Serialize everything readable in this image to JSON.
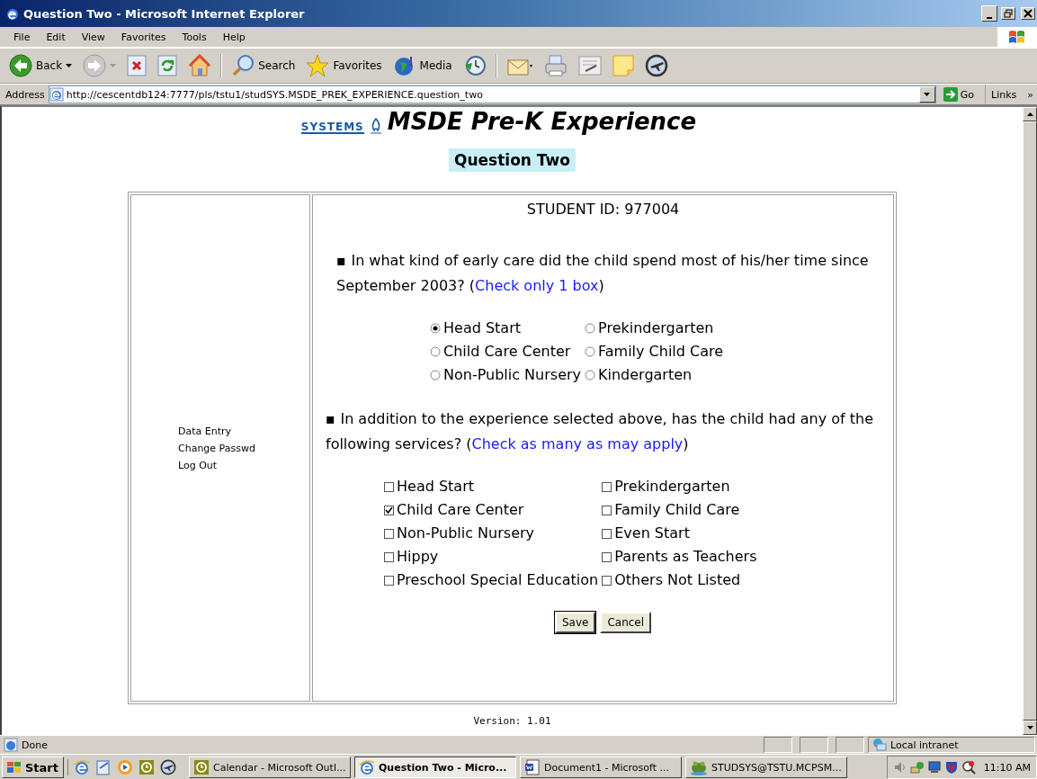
{
  "window": {
    "title": "Question Two - Microsoft Internet Explorer"
  },
  "menu": [
    "File",
    "Edit",
    "View",
    "Favorites",
    "Tools",
    "Help"
  ],
  "toolbar": [
    {
      "kind": "back",
      "label": "Back"
    },
    {
      "kind": "forward"
    },
    {
      "kind": "stop"
    },
    {
      "kind": "refresh"
    },
    {
      "kind": "home"
    },
    {
      "kind": "search",
      "label": "Search"
    },
    {
      "kind": "favorites",
      "label": "Favorites"
    },
    {
      "kind": "media",
      "label": "Media"
    },
    {
      "kind": "history"
    },
    {
      "kind": "mail"
    },
    {
      "kind": "print"
    },
    {
      "kind": "edit"
    },
    {
      "kind": "note"
    },
    {
      "kind": "plane"
    }
  ],
  "address": {
    "label": "Address",
    "value": "http://cescentdb124:7777/pls/tstu1/studSYS.MSDE_PREK_EXPERIENCE.question_two",
    "go": "Go",
    "links": "Links",
    "links_more": "»"
  },
  "page": {
    "logo_text": "SYSTEMS",
    "heading": "MSDE Pre-K Experience",
    "subheading": "Question Two",
    "nav": [
      "Data Entry",
      "Change Passwd",
      "Log Out"
    ],
    "student_id": "STUDENT ID: 977004",
    "questions": [
      {
        "kind": "radio",
        "bullet": "▪",
        "text": "In what kind of early care did the child spend most of his/her time since September 2003? (",
        "hint": "Check only 1 box",
        "close": ")",
        "options": [
          {
            "label": "Head Start",
            "selected": true
          },
          {
            "label": "Prekindergarten",
            "selected": false
          },
          {
            "label": "Child Care Center",
            "selected": false
          },
          {
            "label": "Family Child Care",
            "selected": false
          },
          {
            "label": "Non-Public Nursery",
            "selected": false
          },
          {
            "label": "Kindergarten",
            "selected": false
          }
        ]
      },
      {
        "kind": "checkbox",
        "bullet": "▪",
        "text": "In addition to the experience selected above, has the child had any of the following services? (",
        "hint": "Check as many as may apply",
        "close": ")",
        "options": [
          {
            "label": "Head Start",
            "checked": false
          },
          {
            "label": "Prekindergarten",
            "checked": false
          },
          {
            "label": "Child Care Center",
            "checked": true
          },
          {
            "label": "Family Child Care",
            "checked": false
          },
          {
            "label": "Non-Public Nursery",
            "checked": false
          },
          {
            "label": "Even Start",
            "checked": false
          },
          {
            "label": "Hippy",
            "checked": false
          },
          {
            "label": "Parents as Teachers",
            "checked": false
          },
          {
            "label": "Preschool Special Education",
            "checked": false
          },
          {
            "label": "Others Not Listed",
            "checked": false
          }
        ]
      }
    ],
    "buttons": [
      "Save",
      "Cancel"
    ],
    "version": "Version: 1.01"
  },
  "status_bar": {
    "text": "Done",
    "zone": "Local intranet"
  },
  "taskbar": {
    "start": "Start",
    "tasks": [
      {
        "label": "Calendar - Microsoft Outl...",
        "selected": false
      },
      {
        "label": "Question Two - Micro...",
        "selected": true
      },
      {
        "label": "Document1 - Microsoft ...",
        "selected": false
      },
      {
        "label": "STUDSYS@TSTU.MCPSM...",
        "selected": false
      }
    ],
    "clock": "11:10 AM"
  }
}
